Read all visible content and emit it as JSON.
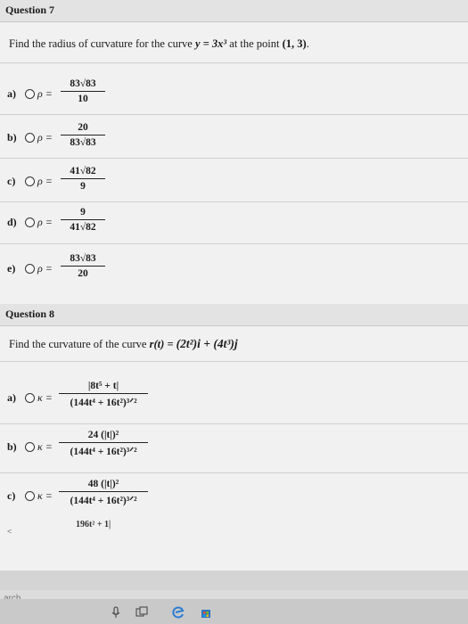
{
  "q7": {
    "title": "Question 7",
    "prompt_pre": "Find the radius of curvature for the curve ",
    "curve": "y = 3x³",
    "prompt_mid": " at the point ",
    "point": "(1, 3)",
    "prompt_end": ".",
    "options": [
      {
        "letter": "a)",
        "sym": "ρ =",
        "num": "83√83",
        "den": "10"
      },
      {
        "letter": "b)",
        "sym": "ρ =",
        "num": "20",
        "den": "83√83"
      },
      {
        "letter": "c)",
        "sym": "ρ =",
        "num": "41√82",
        "den": "9"
      },
      {
        "letter": "d)",
        "sym": "ρ =",
        "num": "9",
        "den": "41√82"
      },
      {
        "letter": "e)",
        "sym": "ρ =",
        "num": "83√83",
        "den": "20"
      }
    ]
  },
  "q8": {
    "title": "Question 8",
    "prompt_pre": "Find the curvature of the curve ",
    "curve_lhs": "r(t) =",
    "curve_rhs": "(2t²)i + (4t³)j",
    "options": [
      {
        "letter": "a)",
        "sym": "κ =",
        "num": "|8t⁵ + t|",
        "den": "(144t⁴ + 16t²)³ᐟ²"
      },
      {
        "letter": "b)",
        "sym": "κ =",
        "num": "24 (|t|)²",
        "den": "(144t⁴ + 16t²)³ᐟ²"
      },
      {
        "letter": "c)",
        "sym": "κ =",
        "num": "48 (|t|)²",
        "den": "(144t⁴ + 16t²)³ᐟ²"
      }
    ],
    "partial_next": "196t² + 1|"
  },
  "os": {
    "search_text": "arch"
  }
}
